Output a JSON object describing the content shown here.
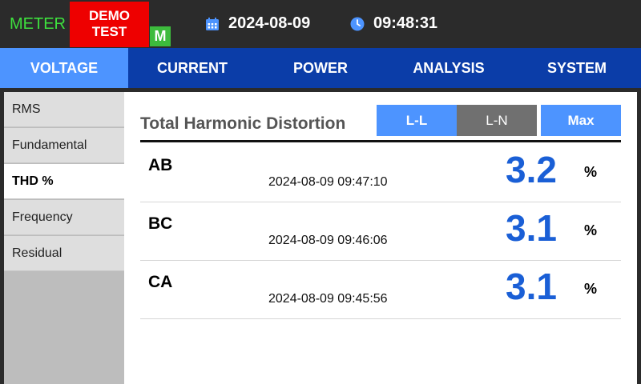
{
  "header": {
    "meter_label": "METER",
    "demo_line1": "DEMO",
    "demo_line2": "TEST",
    "mode_badge": "M",
    "date": "2024-08-09",
    "time": "09:48:31"
  },
  "tabs": [
    {
      "label": "VOLTAGE",
      "active": true
    },
    {
      "label": "CURRENT",
      "active": false
    },
    {
      "label": "POWER",
      "active": false
    },
    {
      "label": "ANALYSIS",
      "active": false
    },
    {
      "label": "SYSTEM",
      "active": false
    }
  ],
  "sidebar": {
    "items": [
      {
        "label": "RMS",
        "active": false
      },
      {
        "label": "Fundamental",
        "active": false
      },
      {
        "label": "THD %",
        "active": true
      },
      {
        "label": "Frequency",
        "active": false
      },
      {
        "label": "Residual",
        "active": false
      }
    ]
  },
  "panel": {
    "title": "Total Harmonic Distortion",
    "buttons": {
      "ll": "L-L",
      "ln": "L-N",
      "max": "Max"
    },
    "rows": [
      {
        "label": "AB",
        "timestamp": "2024-08-09 09:47:10",
        "value": "3.2",
        "unit": "%"
      },
      {
        "label": "BC",
        "timestamp": "2024-08-09 09:46:06",
        "value": "3.1",
        "unit": "%"
      },
      {
        "label": "CA",
        "timestamp": "2024-08-09 09:45:56",
        "value": "3.1",
        "unit": "%"
      }
    ]
  },
  "colors": {
    "accent": "#4d94ff",
    "tab_bar": "#0b3da8",
    "value_blue": "#1a5fd6",
    "demo_red": "#ee0000",
    "meter_green": "#3ee03e"
  },
  "icons": {
    "date": "calendar-icon",
    "time": "clock-icon"
  }
}
